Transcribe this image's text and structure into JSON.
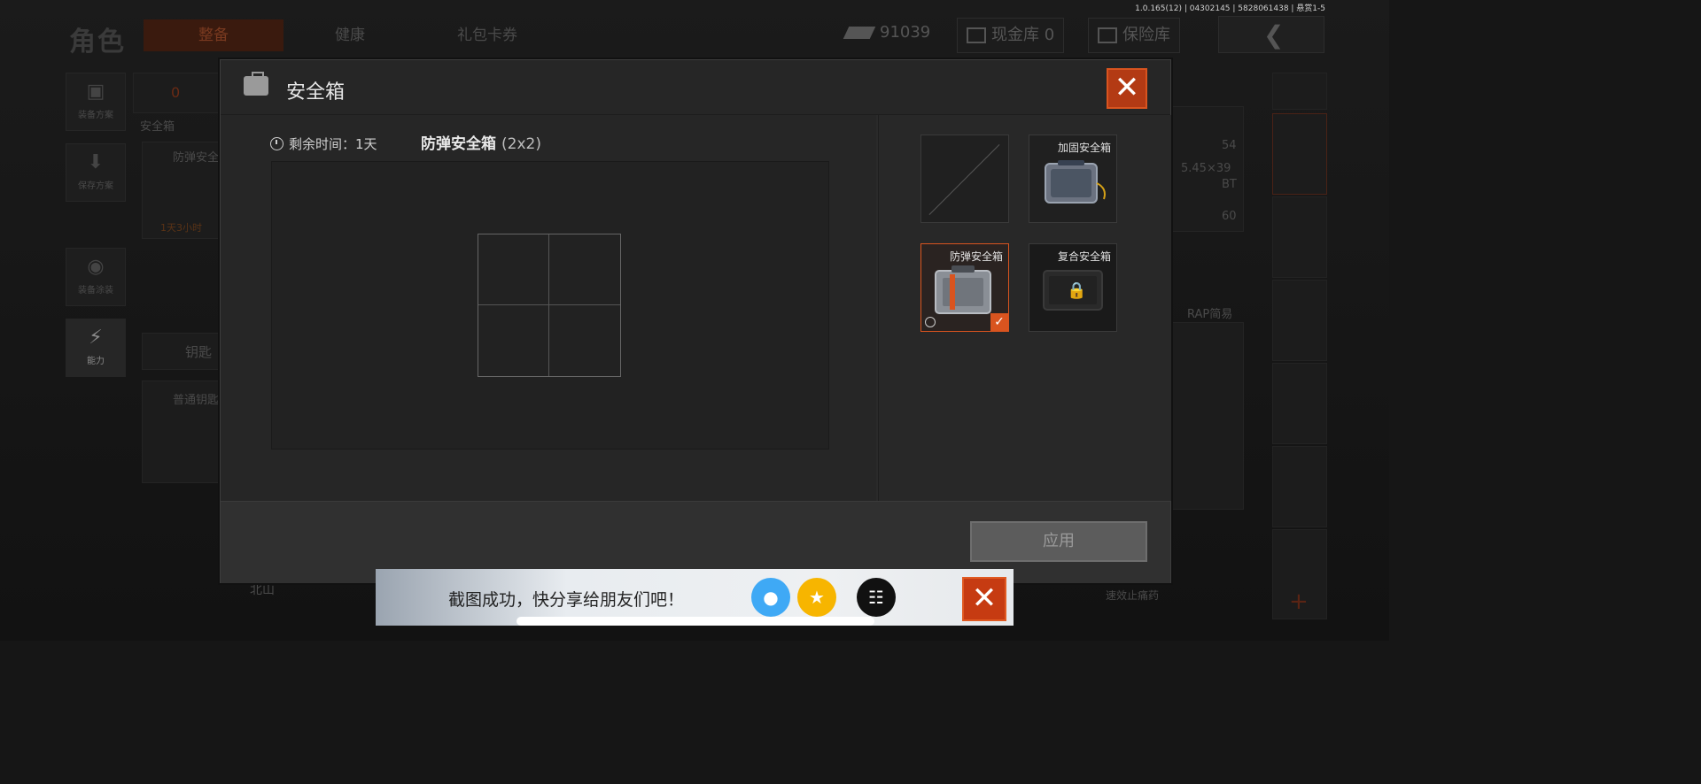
{
  "version_info": "1.0.165(12) | 04302145 | 5828061438 | 悬赏1-5",
  "background": {
    "section_title": "角色",
    "tabs": [
      "整备",
      "健康",
      "礼包卡券"
    ],
    "currency": "91039",
    "cash_vault": "现金库 0",
    "insurance": "保险库",
    "side_items": [
      "装备方案",
      "保存方案",
      "装备涂装",
      "能力"
    ],
    "backpack_count": "0",
    "safe_box_label": "安全箱",
    "bg_case_name": "防弹安全",
    "bg_case_time": "1天3小时",
    "key_label": "钥匙",
    "key_item": "普通钥匙",
    "location": "北山",
    "right_labels": [
      "54",
      "5.45×39",
      "BT",
      "60",
      "RAP简易",
      "速效止痛药"
    ]
  },
  "modal": {
    "title": "安全箱",
    "timer_label": "剩余时间：",
    "timer_value": "1天",
    "case_name": "防弹安全箱",
    "case_size": "(2x2)",
    "slots": [
      {
        "name": "",
        "state": "empty"
      },
      {
        "name": "加固安全箱",
        "state": "available"
      },
      {
        "name": "防弹安全箱",
        "state": "selected"
      },
      {
        "name": "复合安全箱",
        "state": "locked"
      }
    ],
    "apply_label": "应用"
  },
  "toast": {
    "message": "截图成功，快分享给朋友们吧！",
    "share_icons": [
      "qq-icon",
      "qzone-icon",
      "other-share-icon"
    ]
  },
  "colors": {
    "accent": "#d9541f",
    "close_bg": "#b33a14",
    "qq_blue": "#3fa9f5",
    "qzone_yellow": "#f7b500"
  }
}
